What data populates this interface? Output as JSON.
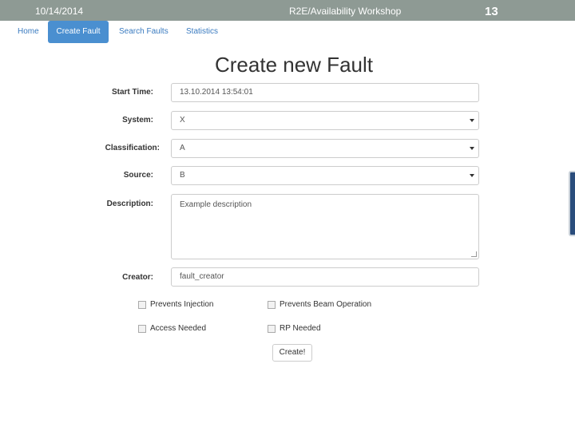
{
  "slide": {
    "date": "10/14/2014",
    "title": "R2E/Availability Workshop",
    "number": "13"
  },
  "nav": {
    "tabs": [
      {
        "label": "Home"
      },
      {
        "label": "Create Fault"
      },
      {
        "label": "Search Faults"
      },
      {
        "label": "Statistics"
      }
    ]
  },
  "form": {
    "heading": "Create new Fault",
    "start_time": {
      "label": "Start Time:",
      "value": "13.10.2014 13:54:01"
    },
    "system": {
      "label": "System:",
      "value": "X"
    },
    "classification": {
      "label": "Classification:",
      "value": "A"
    },
    "source": {
      "label": "Source:",
      "value": "B"
    },
    "description": {
      "label": "Description:",
      "value": "Example description"
    },
    "creator": {
      "label": "Creator:",
      "value": "fault_creator"
    },
    "checkboxes": [
      {
        "label": "Prevents Injection",
        "checked": false
      },
      {
        "label": "Prevents Beam Operation",
        "checked": false
      },
      {
        "label": "Access Needed",
        "checked": false
      },
      {
        "label": "RP Needed",
        "checked": false
      }
    ],
    "submit_label": "Create!"
  }
}
